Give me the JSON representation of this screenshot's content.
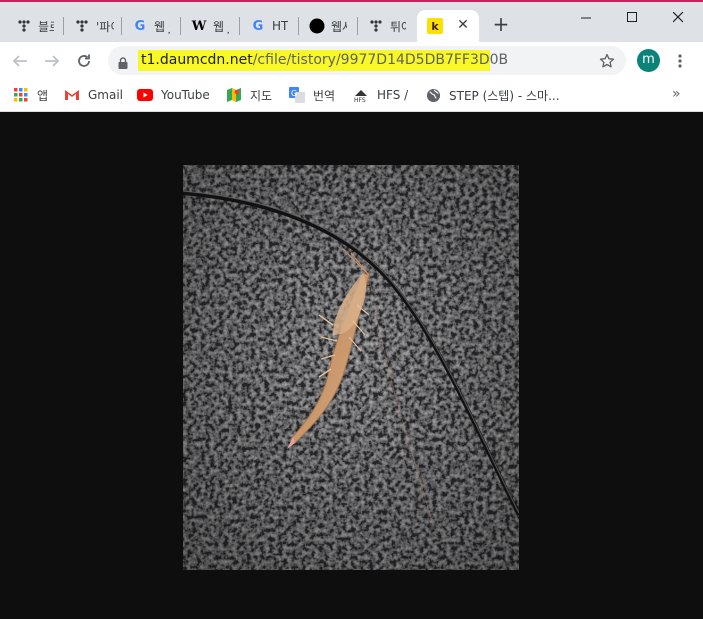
{
  "tabs": [
    {
      "label": "블로",
      "icon": "tistory-icon"
    },
    {
      "label": "'파이",
      "icon": "tistory-icon"
    },
    {
      "label": "웹 J",
      "icon": "google-icon"
    },
    {
      "label": "웹 J",
      "icon": "wikipedia-icon"
    },
    {
      "label": "HTM",
      "icon": "google-icon"
    },
    {
      "label": "웹사",
      "icon": "circle-icon"
    },
    {
      "label": "튀어",
      "icon": "tistory-icon"
    },
    {
      "label": "",
      "icon": "kakao-icon",
      "active": true
    }
  ],
  "address": {
    "host": "t1.daumcdn.net",
    "path": "/cfile/tistory/9977D14D5DB7FF3D0B"
  },
  "profile": {
    "initial": "m",
    "color": "#0b8378"
  },
  "bookmarks": [
    {
      "label": "앱",
      "icon": "apps-grid-icon"
    },
    {
      "label": "Gmail",
      "icon": "gmail-icon"
    },
    {
      "label": "YouTube",
      "icon": "youtube-icon"
    },
    {
      "label": "지도",
      "icon": "maps-icon"
    },
    {
      "label": "번역",
      "icon": "translate-icon"
    },
    {
      "label": "HFS /",
      "icon": "hfs-icon"
    },
    {
      "label": "STEP (스텝) - 스마...",
      "icon": "globe-icon"
    }
  ],
  "bookmarks_more": "»",
  "colors": {
    "url_highlight": "#f8f826",
    "page_bg": "#0e0e0e",
    "tab_strip": "#dee1e6"
  }
}
